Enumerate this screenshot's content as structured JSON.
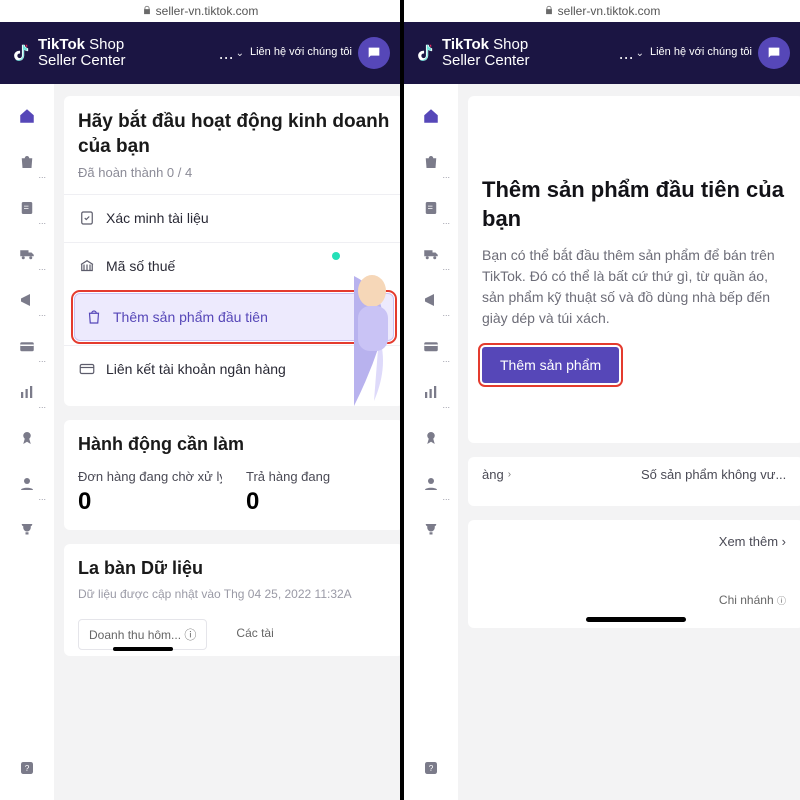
{
  "url_label": "seller-vn.tiktok.com",
  "brand": {
    "line1_bold": "TikTok",
    "line1_light": "Shop",
    "line2": "Seller Center"
  },
  "header": {
    "contact": "Liên hệ với chúng tôi",
    "dots": "..."
  },
  "left": {
    "onboard": {
      "title": "Hãy bắt đầu hoạt động kinh doanh của bạn",
      "progress": "Đã hoàn thành 0 / 4",
      "steps": {
        "verify": "Xác minh tài liệu",
        "tax": "Mã số thuế",
        "first_product": "Thêm sản phẩm đầu tiên",
        "link_bank": "Liên kết tài khoản ngân hàng"
      }
    },
    "todo": {
      "title": "Hành động cần làm",
      "pending_label": "Đơn hàng đang chờ xử lý",
      "pending_value": "0",
      "return_label": "Trả hàng đang",
      "return_value": "0"
    },
    "compass": {
      "title": "La bàn Dữ liệu",
      "updated": "Dữ liệu được cập nhật vào Thg 04 25, 2022 11:32A",
      "chip1": "Doanh thu hôm...",
      "chip2": "Các tài"
    }
  },
  "right": {
    "first_product": {
      "title": "Thêm sản phẩm đầu tiên của bạn",
      "desc": "Bạn có thể bắt đầu thêm sản phẩm để bán trên TikTok. Đó có thể là bất cứ thứ gì, từ quần áo, sản phẩm kỹ thuật số và đồ dùng nhà bếp đến giày dép và túi xách.",
      "cta": "Thêm sản phẩm"
    },
    "metrics": {
      "left_label": "àng",
      "left_value": "",
      "right_label": "Số sản phẩm không vư...",
      "right_value": ""
    },
    "see_more": "Xem thêm",
    "bottom_chip": "Chi nhánh"
  }
}
